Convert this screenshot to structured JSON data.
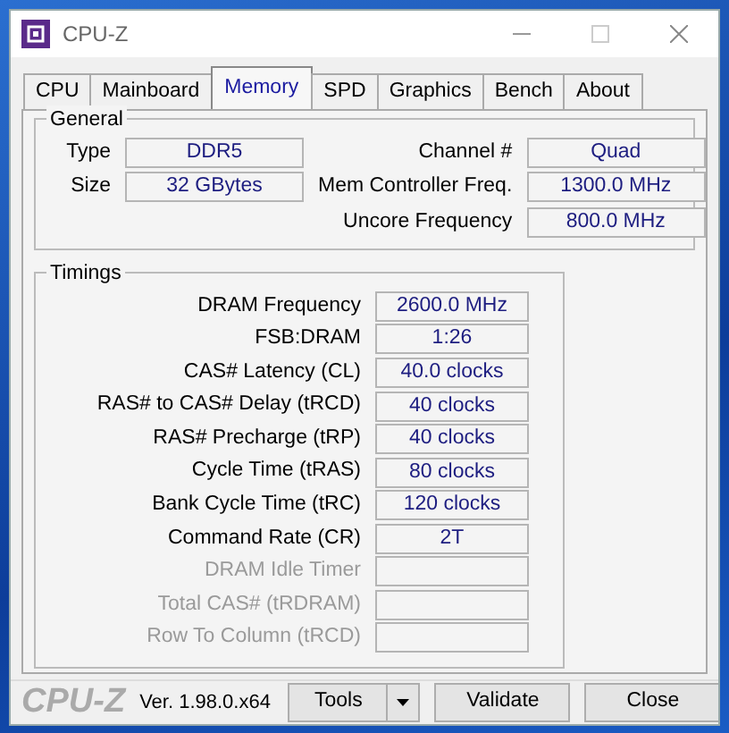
{
  "window": {
    "title": "CPU-Z"
  },
  "tabs": [
    {
      "label": "CPU",
      "selected": false
    },
    {
      "label": "Mainboard",
      "selected": false
    },
    {
      "label": "Memory",
      "selected": true
    },
    {
      "label": "SPD",
      "selected": false
    },
    {
      "label": "Graphics",
      "selected": false
    },
    {
      "label": "Bench",
      "selected": false
    },
    {
      "label": "About",
      "selected": false
    }
  ],
  "general": {
    "title": "General",
    "left": [
      {
        "label": "Type",
        "value": "DDR5"
      },
      {
        "label": "Size",
        "value": "32 GBytes"
      }
    ],
    "right": [
      {
        "label": "Channel #",
        "value": "Quad"
      },
      {
        "label": "Mem Controller Freq.",
        "value": "1300.0 MHz"
      },
      {
        "label": "Uncore Frequency",
        "value": "800.0 MHz"
      }
    ]
  },
  "timings": {
    "title": "Timings",
    "rows": [
      {
        "label": "DRAM Frequency",
        "value": "2600.0 MHz",
        "disabled": false
      },
      {
        "label": "FSB:DRAM",
        "value": "1:26",
        "disabled": false
      },
      {
        "label": "CAS# Latency (CL)",
        "value": "40.0 clocks",
        "disabled": false
      },
      {
        "label": "RAS# to CAS# Delay (tRCD)",
        "value": "40 clocks",
        "disabled": false
      },
      {
        "label": "RAS# Precharge (tRP)",
        "value": "40 clocks",
        "disabled": false
      },
      {
        "label": "Cycle Time (tRAS)",
        "value": "80 clocks",
        "disabled": false
      },
      {
        "label": "Bank Cycle Time (tRC)",
        "value": "120 clocks",
        "disabled": false
      },
      {
        "label": "Command Rate (CR)",
        "value": "2T",
        "disabled": false
      },
      {
        "label": "DRAM Idle Timer",
        "disabled": true
      },
      {
        "label": "Total CAS# (tRDRAM)",
        "disabled": true
      },
      {
        "label": "Row To Column (tRCD)",
        "disabled": true
      }
    ]
  },
  "footer": {
    "logo": "CPU-Z",
    "version": "Ver. 1.98.0.x64",
    "buttons": [
      {
        "label": "Tools",
        "kind": "dropdown"
      },
      {
        "label": "Validate",
        "kind": "plain"
      },
      {
        "label": "Close",
        "kind": "plain"
      }
    ]
  }
}
